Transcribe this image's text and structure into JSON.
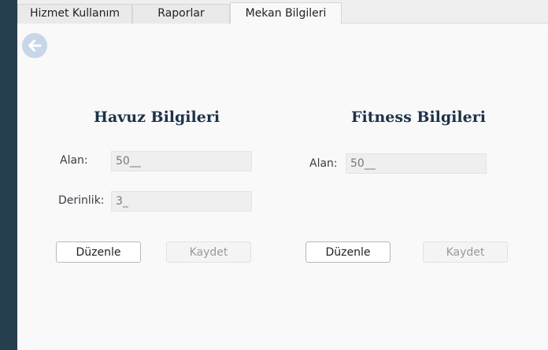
{
  "tabs": [
    {
      "label": "Hizmet Kullanım",
      "active": false
    },
    {
      "label": "Raporlar",
      "active": false
    },
    {
      "label": "Mekan Bilgileri",
      "active": true
    }
  ],
  "back_button": {
    "icon": "arrow-left-icon"
  },
  "pool": {
    "title": "Havuz Bilgileri",
    "area_label": "Alan:",
    "area_value": "50__",
    "depth_label": "Derinlik:",
    "depth_value": "3_",
    "edit_label": "Düzenle",
    "save_label": "Kaydet"
  },
  "fitness": {
    "title": "Fitness Bilgileri",
    "area_label": "Alan:",
    "area_value": "50__",
    "edit_label": "Düzenle",
    "save_label": "Kaydet"
  },
  "colors": {
    "sidebar": "#263f4f",
    "title": "#1d3149",
    "back_button": "#c9d6e8"
  }
}
